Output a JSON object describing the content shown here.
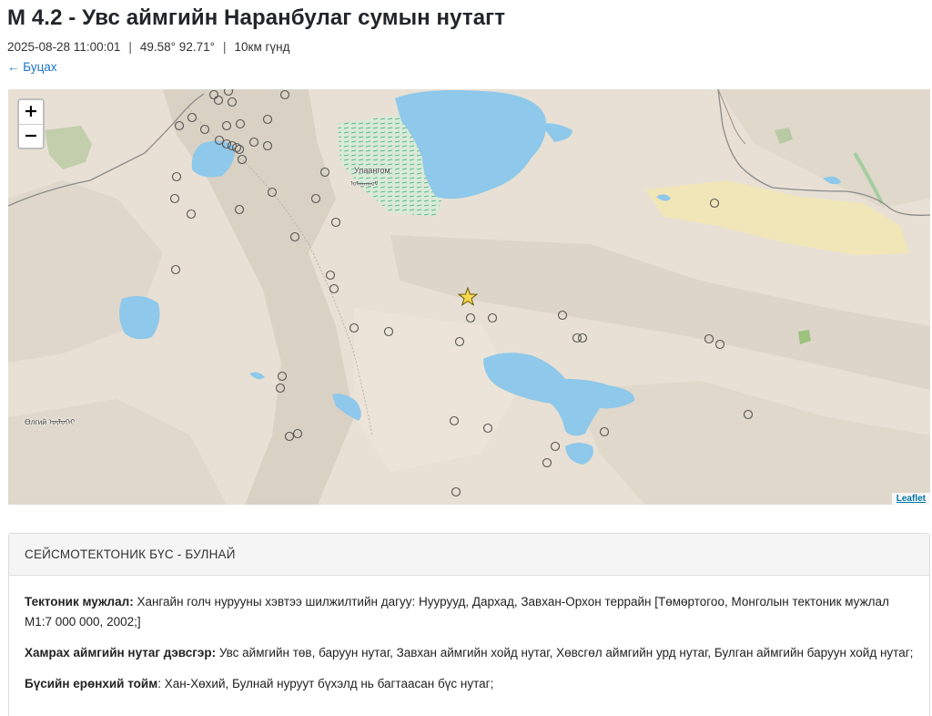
{
  "page": {
    "title": "M 4.2 - Увс аймгийн Наранбулаг сумын нутагт",
    "datetime": "2025-08-28 11:00:01",
    "coords": "49.58° 92.71°",
    "depth": "10км гүнд",
    "separator": "|",
    "back_label": "← Буцах"
  },
  "map": {
    "zoom_in_label": "+",
    "zoom_out_label": "−",
    "attribution": "Leaflet",
    "places": {
      "ulaangom": "Улаангом",
      "ulaangom_native": "ᠤᠯᠠᠭᠠᠨᠭᠣᠮ",
      "olgii": "Өлгий ᠥᠯᠦᠭᠡᠢ"
    },
    "colors": {
      "land": "#e8e0d4",
      "water": "#8ec8ea",
      "marsh": "#7fc7a6",
      "sand": "#f1e6b8",
      "border": "#8a8a8a",
      "quake_marker": "#ffffff",
      "epicenter_star": "#f7d84a"
    }
  },
  "info": {
    "header": "СЕЙСМОТЕКТОНИК БҮС - БУЛНАЙ",
    "rows": [
      {
        "label": "Тектоник мужлал:",
        "text": " Хангайн голч нурууны хэвтээ шилжилтийн дагуу: Нуурууд, Дархад, Завхан-Орхон террайн [Төмөртогоо, Монголын тектоник мужлал М1:7 000 000, 2002;]"
      },
      {
        "label": "Хамрах аймгийн нутаг дэвсгэр:",
        "text": " Увс аймгийн төв, баруун нутаг, Завхан аймгийн хойд нутаг, Хөвсгөл аймгийн урд нутаг, Булган аймгийн баруун хойд нутаг;"
      },
      {
        "label": "Бүсийн ерөнхий тойм",
        "text": ": Хан-Хөхий, Булнай нуруут бүхэлд нь багтаасан бүс нутаг;"
      }
    ]
  }
}
